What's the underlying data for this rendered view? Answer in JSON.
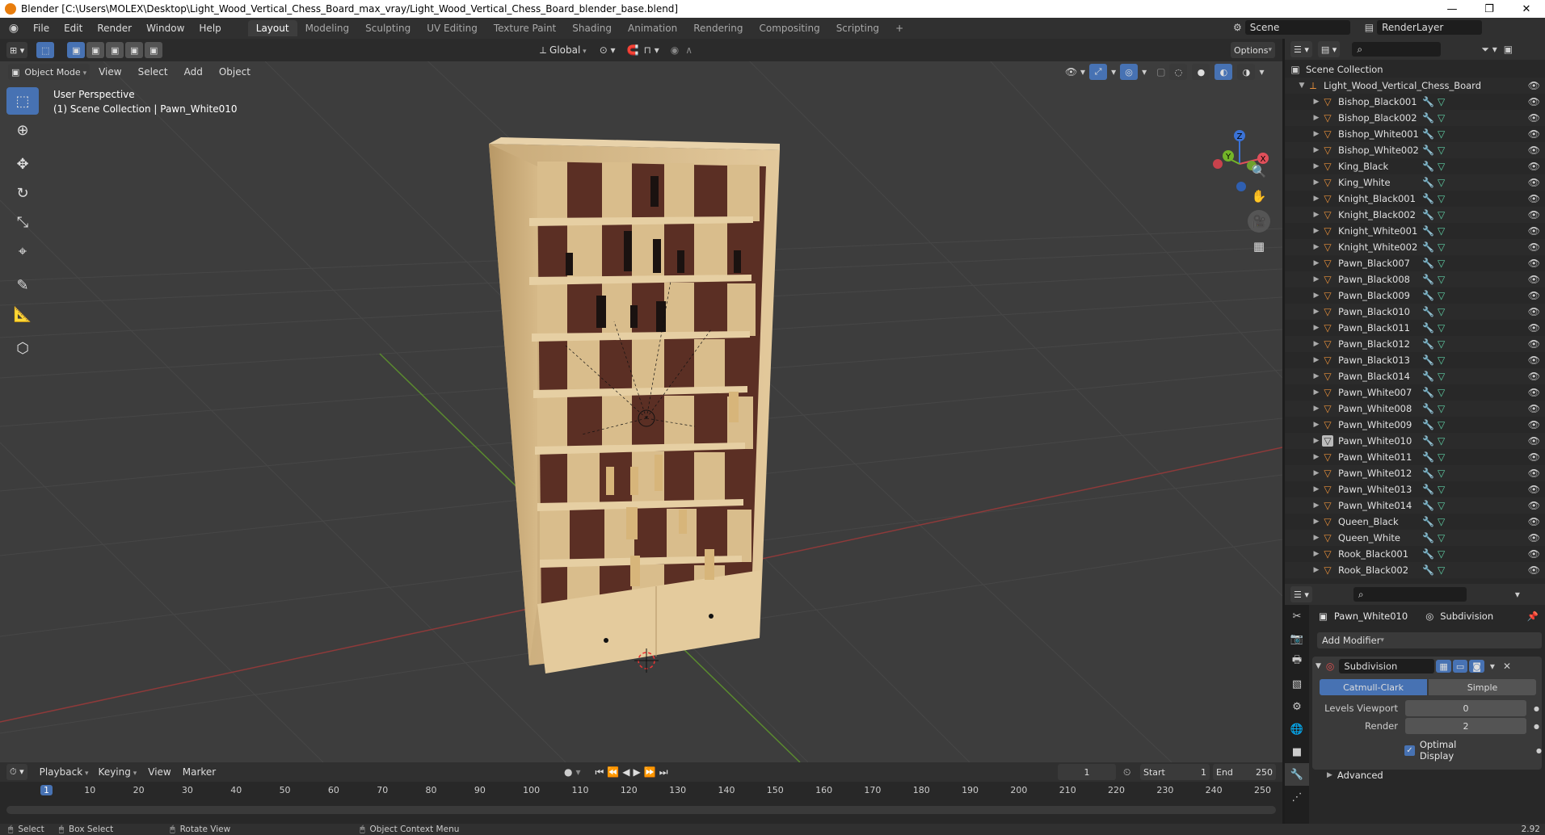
{
  "window": {
    "title": "Blender [C:\\Users\\MOLEX\\Desktop\\Light_Wood_Vertical_Chess_Board_max_vray/Light_Wood_Vertical_Chess_Board_blender_base.blend]",
    "minimize": "—",
    "maximize": "❐",
    "close": "✕"
  },
  "menus": [
    "File",
    "Edit",
    "Render",
    "Window",
    "Help"
  ],
  "workspaces": [
    "Layout",
    "Modeling",
    "Sculpting",
    "UV Editing",
    "Texture Paint",
    "Shading",
    "Animation",
    "Rendering",
    "Compositing",
    "Scripting"
  ],
  "workspace_add": "+",
  "scene": {
    "name": "Scene",
    "render_layer": "RenderLayer"
  },
  "viewport": {
    "transform_orientation": "Global",
    "options_label": "Options",
    "mode": "Object Mode",
    "menu": [
      "View",
      "Select",
      "Add",
      "Object"
    ],
    "view_name": "User Perspective",
    "collection_info": "(1) Scene Collection | Pawn_White010",
    "gizmo": {
      "x": "X",
      "y": "Y",
      "z": "Z"
    }
  },
  "outliner": {
    "root": "Scene Collection",
    "collection": "Light_Wood_Vertical_Chess_Board",
    "items": [
      "Bishop_Black001",
      "Bishop_Black002",
      "Bishop_White001",
      "Bishop_White002",
      "King_Black",
      "King_White",
      "Knight_Black001",
      "Knight_Black002",
      "Knight_White001",
      "Knight_White002",
      "Pawn_Black007",
      "Pawn_Black008",
      "Pawn_Black009",
      "Pawn_Black010",
      "Pawn_Black011",
      "Pawn_Black012",
      "Pawn_Black013",
      "Pawn_Black014",
      "Pawn_White007",
      "Pawn_White008",
      "Pawn_White009",
      "Pawn_White010",
      "Pawn_White011",
      "Pawn_White012",
      "Pawn_White013",
      "Pawn_White014",
      "Queen_Black",
      "Queen_White",
      "Rook_Black001",
      "Rook_Black002"
    ],
    "selected": "Pawn_White010"
  },
  "properties": {
    "object": "Pawn_White010",
    "modifier_name_crumb": "Subdivision",
    "add_modifier": "Add Modifier",
    "modifier": {
      "name": "Subdivision",
      "types": [
        "Catmull-Clark",
        "Simple"
      ],
      "active_type": "Catmull-Clark",
      "levels_viewport_label": "Levels Viewport",
      "levels_viewport": "0",
      "render_label": "Render",
      "render": "2",
      "optimal_display": "Optimal Display",
      "advanced": "Advanced"
    }
  },
  "timeline": {
    "menus": [
      "Playback",
      "Keying",
      "View",
      "Marker"
    ],
    "current_frame": "1",
    "start_label": "Start",
    "start": "1",
    "end_label": "End",
    "end": "250",
    "ticks": [
      "1",
      "10",
      "20",
      "30",
      "40",
      "50",
      "60",
      "70",
      "80",
      "90",
      "100",
      "110",
      "120",
      "130",
      "140",
      "150",
      "160",
      "170",
      "180",
      "190",
      "200",
      "210",
      "220",
      "230",
      "240",
      "250"
    ]
  },
  "status": {
    "select": "Select",
    "box_select": "Box Select",
    "rotate_view": "Rotate View",
    "context_menu": "Object Context Menu",
    "version": "2.92"
  }
}
